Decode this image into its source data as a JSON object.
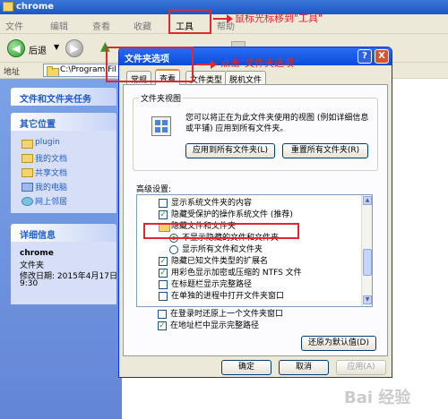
{
  "window": {
    "title": "chrome",
    "menu": [
      "文件",
      "编辑",
      "查看",
      "收藏",
      "工具",
      "帮助"
    ],
    "toolbar": {
      "back_label": "后退",
      "back_arrow": "▼",
      "address_label": "地址",
      "address_value": "C:\\Program Fil"
    }
  },
  "left_pane": {
    "file_tasks_header": "文件和文件夹任务",
    "other_places": {
      "header": "其它位置",
      "items": [
        "plugin",
        "我的文档",
        "共享文档",
        "我的电脑",
        "网上邻居"
      ]
    },
    "details": {
      "header": "详细信息",
      "name": "chrome",
      "type": "文件夹",
      "modified": "修改日期: 2015年4月17日",
      "time": "9:30"
    }
  },
  "dialog": {
    "title": "文件夹选项",
    "help_btn": "?",
    "close_btn": "X",
    "tabs": [
      "常规",
      "查看",
      "文件类型",
      "脱机文件"
    ],
    "active_tab": "查看",
    "folder_view": {
      "group_label": "文件夹视图",
      "description": "您可以将正在为此文件夹使用的视图 (例如详细信息或平铺) 应用到所有文件夹。",
      "apply_all": "应用到所有文件夹(L)",
      "reset_all": "重置所有文件夹(R)"
    },
    "advanced_label": "高级设置:",
    "settings": [
      {
        "label": "显示系统文件夹的内容",
        "kind": "checkbox",
        "checked": false
      },
      {
        "label": "隐藏受保护的操作系统文件 (推荐)",
        "kind": "checkbox",
        "checked": true
      },
      {
        "label": "隐藏文件和文件夹",
        "kind": "folder"
      },
      {
        "label": "不显示隐藏的文件和文件夹",
        "kind": "radio",
        "checked": true
      },
      {
        "label": "显示所有文件和文件夹",
        "kind": "radio",
        "checked": false
      },
      {
        "label": "隐藏已知文件类型的扩展名",
        "kind": "checkbox",
        "checked": true
      },
      {
        "label": "用彩色显示加密或压缩的 NTFS 文件",
        "kind": "checkbox",
        "checked": true
      },
      {
        "label": "在标题栏显示完整路径",
        "kind": "checkbox",
        "checked": false
      },
      {
        "label": "在单独的进程中打开文件夹窗口",
        "kind": "checkbox",
        "checked": false
      },
      {
        "label": "在登录时还原上一个文件夹窗口",
        "kind": "checkbox",
        "checked": false
      },
      {
        "label": "在地址栏中显示完整路径",
        "kind": "checkbox",
        "checked": true
      }
    ],
    "restore_defaults": "还原为默认值(D)",
    "ok": "确定",
    "cancel": "取消",
    "apply": "应用(A)"
  },
  "annotations": {
    "tools_note": "鼠标光标移到\"工具\"",
    "options_note": "点击\"文件夹选项\""
  },
  "watermark": "Bai 经验"
}
